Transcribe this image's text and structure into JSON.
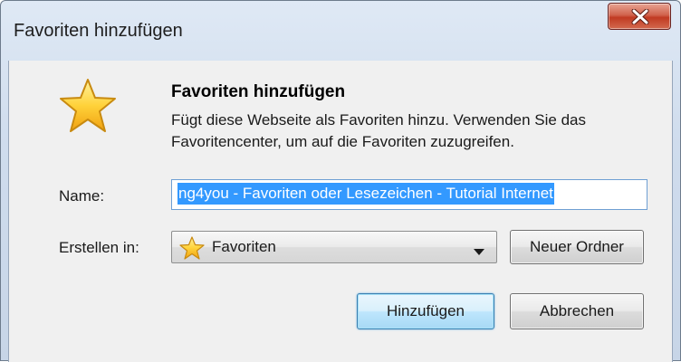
{
  "window": {
    "title": "Favoriten hinzufügen",
    "close_icon": "close-x-icon"
  },
  "header": {
    "icon": "star-icon",
    "heading": "Favoriten hinzufügen",
    "description": "Fügt diese Webseite als Favoriten hinzu. Verwenden Sie das Favoritencenter, um auf die Favoriten zuzugreifen."
  },
  "form": {
    "name_label": "Name:",
    "name_value": "ng4you - Favoriten oder Lesezeichen - Tutorial Internet",
    "create_in_label": "Erstellen in:",
    "create_in_value": "Favoriten",
    "create_in_icon": "star-icon",
    "new_folder_label": "Neuer Ordner"
  },
  "actions": {
    "add_label": "Hinzufügen",
    "cancel_label": "Abbrechen"
  },
  "colors": {
    "selection": "#3399ff",
    "close_button": "#c03a22",
    "dialog_background": "#f0f0f0"
  }
}
